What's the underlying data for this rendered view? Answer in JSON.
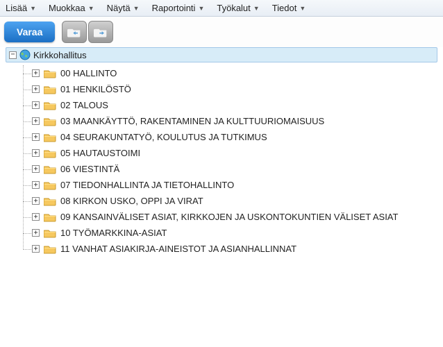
{
  "menu": [
    "Lisää",
    "Muokkaa",
    "Näytä",
    "Raportointi",
    "Työkalut",
    "Tiedot"
  ],
  "toolbar": {
    "varaa": "Varaa"
  },
  "tree": {
    "root": "Kirkkohallitus",
    "items": [
      "00 HALLINTO",
      "01 HENKILÖSTÖ",
      "02 TALOUS",
      "03 MAANKÄYTTÖ, RAKENTAMINEN JA KULTTUURIOMAISUUS",
      "04 SEURAKUNTATYÖ, KOULUTUS JA TUTKIMUS",
      "05 HAUTAUSTOIMI",
      "06 VIESTINTÄ",
      "07 TIEDONHALLINTA JA TIETOHALLINTO",
      "08 KIRKON USKO, OPPI JA VIRAT",
      "09 KANSAINVÄLISET ASIAT, KIRKKOJEN JA USKONTOKUNTIEN VÄLISET ASIAT",
      "10 TYÖMARKKINA-ASIAT",
      "11 VANHAT ASIAKIRJA-AINEISTOT JA ASIANHALLINNAT"
    ]
  }
}
